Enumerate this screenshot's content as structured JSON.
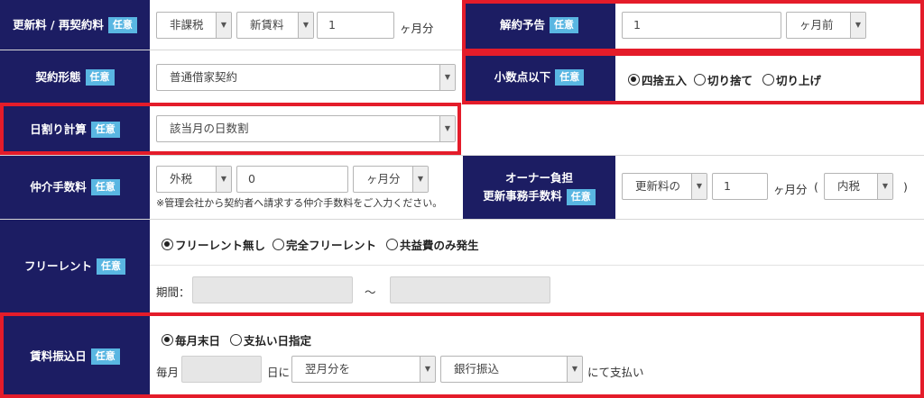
{
  "badge": "任意",
  "renewal_fee": {
    "label": "更新料 / 再契約料",
    "tax_select": "非課税",
    "basis_select": "新賃料",
    "amount": "1",
    "unit": "ヶ月分"
  },
  "cancel_notice": {
    "label": "解約予告",
    "amount": "1",
    "unit_select": "ヶ月前"
  },
  "contract_type": {
    "label": "契約形態",
    "select": "普通借家契約"
  },
  "decimal": {
    "label": "小数点以下",
    "options": [
      "四捨五入",
      "切り捨て",
      "切り上げ"
    ],
    "selected_index": 0
  },
  "daily_calc": {
    "label": "日割り計算",
    "select": "該当月の日数割"
  },
  "brokerage": {
    "label": "仲介手数料",
    "tax_select": "外税",
    "amount": "0",
    "unit_select": "ヶ月分",
    "note": "※管理会社から契約者へ請求する仲介手数料をご入力ください。"
  },
  "owner_fee": {
    "label_line1": "オーナー負担",
    "label_line2": "更新事務手数料",
    "basis_select": "更新料の",
    "amount": "1",
    "unit": "ヶ月分",
    "paren_open": "(",
    "tax_select": "内税",
    "paren_close": ")"
  },
  "free_rent": {
    "label": "フリーレント",
    "options": [
      "フリーレント無し",
      "完全フリーレント",
      "共益費のみ発生"
    ],
    "selected_index": 0,
    "period_label": "期間：",
    "tilde": "～",
    "start": "",
    "end": ""
  },
  "rent_transfer": {
    "label": "賃料振込日",
    "options": [
      "毎月末日",
      "支払い日指定"
    ],
    "selected_index": 0,
    "prefix": "毎月",
    "day": "",
    "day_suffix": "日に",
    "month_select": "翌月分を",
    "method_select": "銀行振込",
    "suffix": "にて支払い"
  }
}
